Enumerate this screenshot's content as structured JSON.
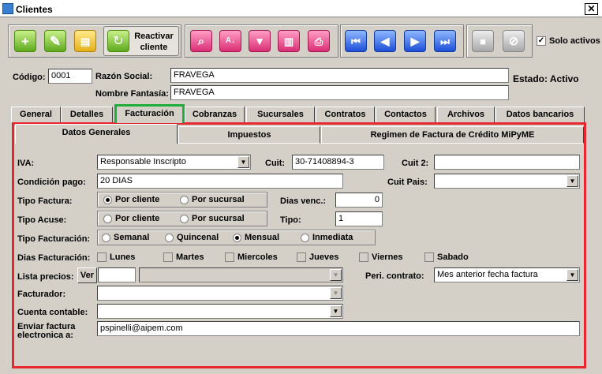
{
  "window": {
    "title": "Clientes",
    "close_glyph": "✕"
  },
  "toolbar": {
    "reactivar_label": "Reactivar cliente",
    "solo_activos_label": "Solo activos",
    "solo_activos_checked": true,
    "icons": [
      "add-icon",
      "edit-icon",
      "document-icon",
      "reactivate-icon",
      "search-icon",
      "sort-az-icon",
      "filter-icon",
      "report-icon",
      "print-icon",
      "first-icon",
      "previous-icon",
      "next-icon",
      "last-icon",
      "save-icon",
      "cancel-icon"
    ]
  },
  "header": {
    "codigo_label": "Código:",
    "codigo_value": "0001",
    "razon_social_label": "Razón Social:",
    "razon_social_value": "FRAVEGA",
    "nombre_fantasia_label": "Nombre Fantasía:",
    "nombre_fantasia_value": "FRAVEGA",
    "estado": "Estado: Activo"
  },
  "tabs": [
    {
      "label": "General"
    },
    {
      "label": "Detalles"
    },
    {
      "label": "Facturación"
    },
    {
      "label": "Cobranzas"
    },
    {
      "label": "Sucursales"
    },
    {
      "label": "Contratos"
    },
    {
      "label": "Contactos"
    },
    {
      "label": "Archivos"
    },
    {
      "label": "Datos bancarios"
    }
  ],
  "subtabs": [
    {
      "label": "Datos Generales"
    },
    {
      "label": "Impuestos"
    },
    {
      "label": "Regimen de Factura de Crédito MiPyME"
    }
  ],
  "form": {
    "iva_label": "IVA:",
    "iva_value": "Responsable Inscripto",
    "cuit_label": "Cuit:",
    "cuit_value": "30-71408894-3",
    "cuit2_label": "Cuit 2:",
    "cuit2_value": "",
    "condicion_pago_label": "Condición pago:",
    "condicion_pago_value": "20 DIAS",
    "cuit_pais_label": "Cuit Pais:",
    "cuit_pais_value": "",
    "tipo_factura_label": "Tipo Factura:",
    "tipo_factura_options": [
      "Por cliente",
      "Por sucursal"
    ],
    "dias_venc_label": "Dias venc.:",
    "dias_venc_value": "0",
    "tipo_acuse_label": "Tipo Acuse:",
    "tipo_acuse_options": [
      "Por cliente",
      "Por sucursal"
    ],
    "tipo_label": "Tipo:",
    "tipo_value": "1",
    "tipo_facturacion_label": "Tipo Facturación:",
    "tipo_facturacion_options": [
      "Semanal",
      "Quincenal",
      "Mensual",
      "Inmediata"
    ],
    "dias_facturacion_label": "Dias Facturación:",
    "dias": [
      "Lunes",
      "Martes",
      "Miercoles",
      "Jueves",
      "Viernes",
      "Sabado"
    ],
    "lista_precios_label": "Lista precios:",
    "ver_label": "Ver",
    "lista_precios_code": "",
    "lista_precios_value": "",
    "peri_contrato_label": "Peri. contrato:",
    "peri_contrato_value": "Mes anterior fecha factura",
    "facturador_label": "Facturador:",
    "facturador_value": "",
    "cuenta_contable_label": "Cuenta contable:",
    "cuenta_contable_value": "",
    "enviar_factura_label_1": "Enviar factura",
    "enviar_factura_label_2": "electronica a:",
    "enviar_factura_value": "pspinelli@aipem.com"
  },
  "colors": {
    "highlight_red": "#e8262f",
    "highlight_green": "#1fae3c"
  }
}
